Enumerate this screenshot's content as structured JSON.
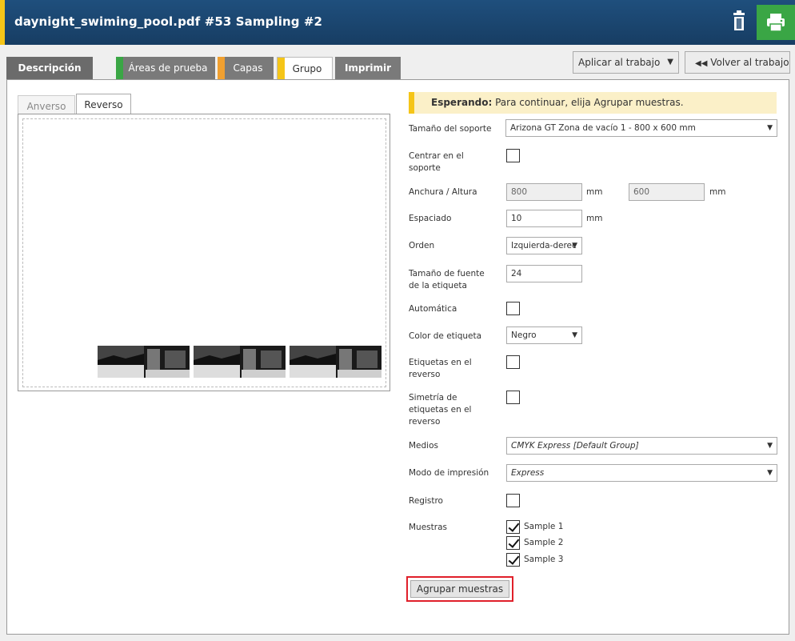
{
  "header": {
    "title": "daynight_swiming_pool.pdf #53 Sampling #2",
    "accent_color": "#f5c518",
    "print_color": "#3aa645"
  },
  "tabs": [
    {
      "label": "Descripción",
      "color": ""
    },
    {
      "label": "Áreas de prueba",
      "color": "#3aa645"
    },
    {
      "label": "Capas",
      "color": "#f0a030"
    },
    {
      "label": "Grupo",
      "color": "#f5c518"
    },
    {
      "label": "Imprimir",
      "color": ""
    }
  ],
  "toolbar": {
    "apply_select": "Aplicar al trabajo",
    "back_label": "Volver al trabajo"
  },
  "preview": {
    "tab_front": "Anverso",
    "tab_back": "Reverso"
  },
  "banner": {
    "strong": "Esperando:",
    "text": " Para continuar, elija Agrupar muestras."
  },
  "form": {
    "support_size_label": "Tamaño del soporte",
    "support_size_value": "Arizona GT Zona de vacío 1 - 800 x 600 mm",
    "center_label": "Centrar en el soporte",
    "width_height_label": "Anchura / Altura",
    "width_value": "800",
    "height_value": "600",
    "unit_mm": "mm",
    "spacing_label": "Espaciado",
    "spacing_value": "10",
    "order_label": "Orden",
    "order_value": "Izquierda-derec",
    "font_size_label": "Tamaño de fuente de la etiqueta",
    "font_size_value": "24",
    "auto_label": "Automática",
    "label_color_label": "Color de etiqueta",
    "label_color_value": "Negro",
    "back_labels_label": "Etiquetas en el reverso",
    "mirror_label": "Simetría de etiquetas en el reverso",
    "media_label": "Medios",
    "media_value": "CMYK Express [Default Group]",
    "print_mode_label": "Modo de impresión",
    "print_mode_value": "Express",
    "register_label": "Registro",
    "samples_label": "Muestras",
    "samples": [
      "Sample 1",
      "Sample 2",
      "Sample 3"
    ]
  },
  "group_button": "Agrupar muestras"
}
